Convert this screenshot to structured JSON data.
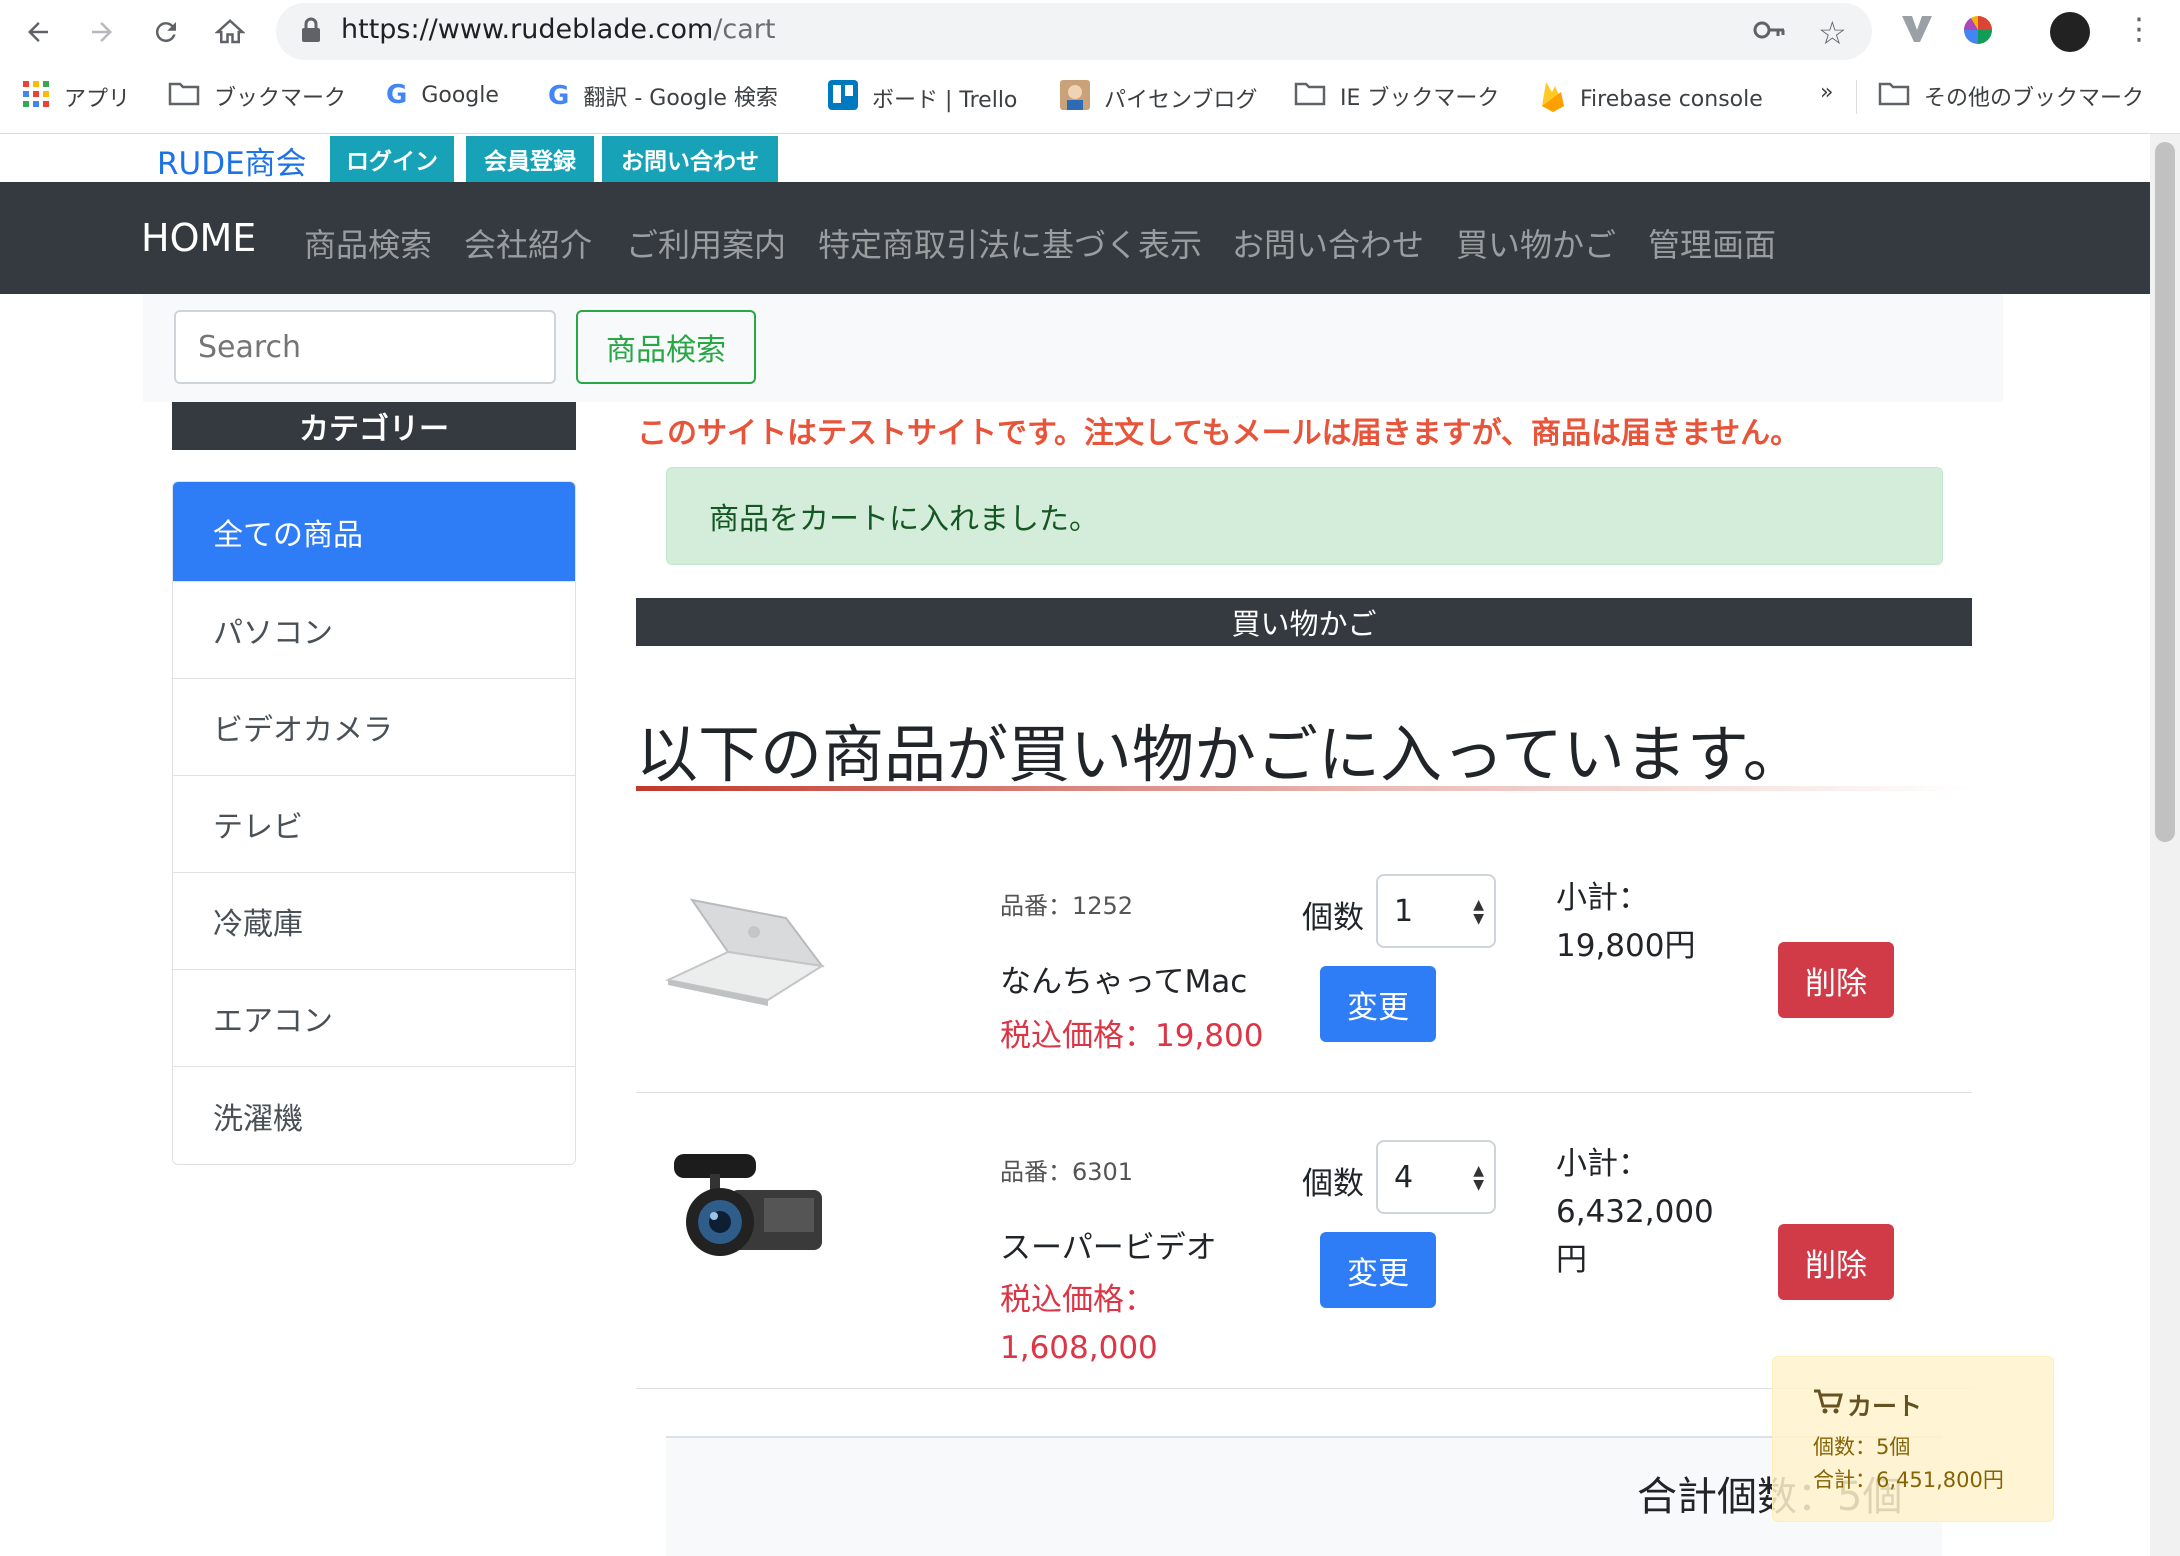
{
  "browser": {
    "url_host": "https://www.rudeblade.com",
    "url_path": "/cart",
    "bookmarks": [
      "アプリ",
      "ブックマーク",
      "Google",
      "翻訳 - Google 検索",
      "ボード | Trello",
      "パイセンブログ",
      "IE ブックマーク",
      "Firebase console",
      "»",
      "その他のブックマーク"
    ]
  },
  "site": {
    "brand": "RUDE商会",
    "top_buttons": [
      "ログイン",
      "会員登録",
      "お問い合わせ"
    ],
    "nav_home": "HOME",
    "nav_links": [
      "商品検索",
      "会社紹介",
      "ご利用案内",
      "特定商取引法に基づく表示",
      "お問い合わせ",
      "買い物かご",
      "管理画面"
    ],
    "search_placeholder": "Search",
    "search_button": "商品検索"
  },
  "sidebar": {
    "header": "カテゴリー",
    "items": [
      "全ての商品",
      "パソコン",
      "ビデオカメラ",
      "テレビ",
      "冷蔵庫",
      "エアコン",
      "洗濯機"
    ]
  },
  "main": {
    "notice": "このサイトはテストサイトです。注文してもメールは届きますが、商品は届きません。",
    "alert": "商品をカートに入れました。",
    "cart_title": "買い物かご",
    "heading": "以下の商品が買い物かごに入っています。",
    "items": [
      {
        "no": "品番：1252",
        "name": "なんちゃってMac",
        "price_line1": "税込価格：19,800",
        "price_line2": "",
        "qty_label": "個数",
        "qty": "1",
        "change": "変更",
        "subtotal_line1": "小計：",
        "subtotal_line2": "19,800円",
        "subtotal_line3": "",
        "delete": "削除"
      },
      {
        "no": "品番：6301",
        "name": "スーパービデオ",
        "price_line1": "税込価格：",
        "price_line2": "1,608,000",
        "qty_label": "個数",
        "qty": "4",
        "change": "変更",
        "subtotal_line1": "小計：",
        "subtotal_line2": "6,432,000",
        "subtotal_line3": "円",
        "delete": "削除"
      }
    ],
    "total": "合計個数：5個"
  },
  "mini_cart": {
    "title": "カート",
    "count": "個数：5個",
    "sum": "合計：6,451,800円"
  }
}
